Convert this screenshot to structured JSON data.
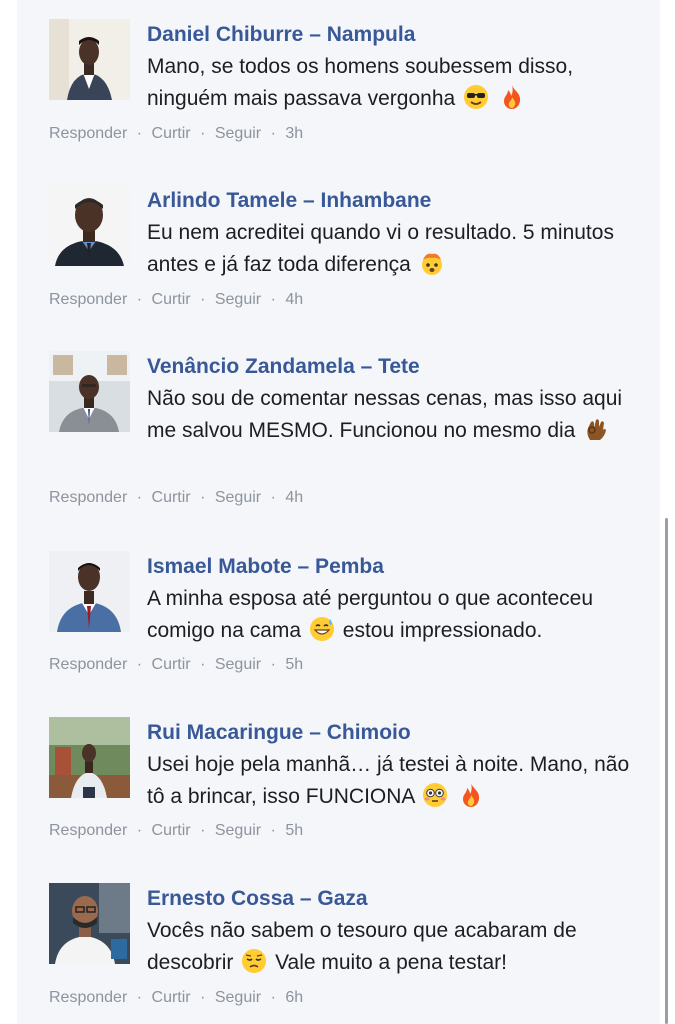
{
  "comments": [
    {
      "author": "Daniel Chiburre – Nampula",
      "text_parts": [
        "Mano, se todos os homens soubessem disso, ninguém mais passava vergonha",
        ""
      ],
      "emojis": [
        "sunglasses-emoji",
        "fire-emoji"
      ],
      "actions": {
        "reply": "Responder",
        "like": "Curtir",
        "follow": "Seguir",
        "time": "3h"
      },
      "avatar_bg": "#f2efe9",
      "shirt": "#3a4458"
    },
    {
      "author": "Arlindo Tamele – Inhambane",
      "text_parts": [
        "Eu nem acreditei quando vi o resultado. 5 minutos antes e já faz toda diferença",
        ""
      ],
      "emojis": [
        "exploding-head-emoji"
      ],
      "actions": {
        "reply": "Responder",
        "like": "Curtir",
        "follow": "Seguir",
        "time": "4h"
      },
      "avatar_bg": "#f5f5f5",
      "shirt": "#1f2733"
    },
    {
      "author": "Venâncio Zandamela – Tete",
      "text_parts": [
        "Não sou de comentar nessas cenas, mas isso aqui me salvou MESMO. Funcionou no mesmo dia",
        ""
      ],
      "emojis": [
        "ok-hand-emoji"
      ],
      "actions": {
        "reply": "Responder",
        "like": "Curtir",
        "follow": "Seguir",
        "time": "4h"
      },
      "avatar_bg": "#d9dee3",
      "shirt": "#8a8e95"
    },
    {
      "author": "Ismael Mabote – Pemba",
      "text_parts": [
        "A minha esposa até perguntou o que aconteceu comigo na cama",
        "estou impressionado."
      ],
      "emojis": [
        "grinning-sweat-emoji"
      ],
      "actions": {
        "reply": "Responder",
        "like": "Curtir",
        "follow": "Seguir",
        "time": "5h"
      },
      "avatar_bg": "#eef0f3",
      "shirt": "#4a6fa5"
    },
    {
      "author": "Rui Macaringue – Chimoio",
      "text_parts": [
        "Usei hoje pela manhã… já testei à noite. Mano, não tô a brincar, isso FUNCIONA",
        ""
      ],
      "emojis": [
        "flushed-emoji",
        "fire-emoji"
      ],
      "actions": {
        "reply": "Responder",
        "like": "Curtir",
        "follow": "Seguir",
        "time": "5h"
      },
      "avatar_bg": "#6f8a5c",
      "shirt": "#e8ecf0"
    },
    {
      "author": "Ernesto Cossa – Gaza",
      "text_parts": [
        "Vocês não sabem o tesouro que acabaram de descobrir",
        "Vale muito a pena testar!"
      ],
      "emojis": [
        "pensive-emoji"
      ],
      "actions": {
        "reply": "Responder",
        "like": "Curtir",
        "follow": "Seguir",
        "time": "6h"
      },
      "avatar_bg": "#3a4a5a",
      "shirt": "#f4f4f4"
    }
  ],
  "colors": {
    "author": "#385898",
    "text": "#1c1e21",
    "meta": "#8d949e",
    "panel": "#f4f6f9"
  },
  "separator": "·"
}
